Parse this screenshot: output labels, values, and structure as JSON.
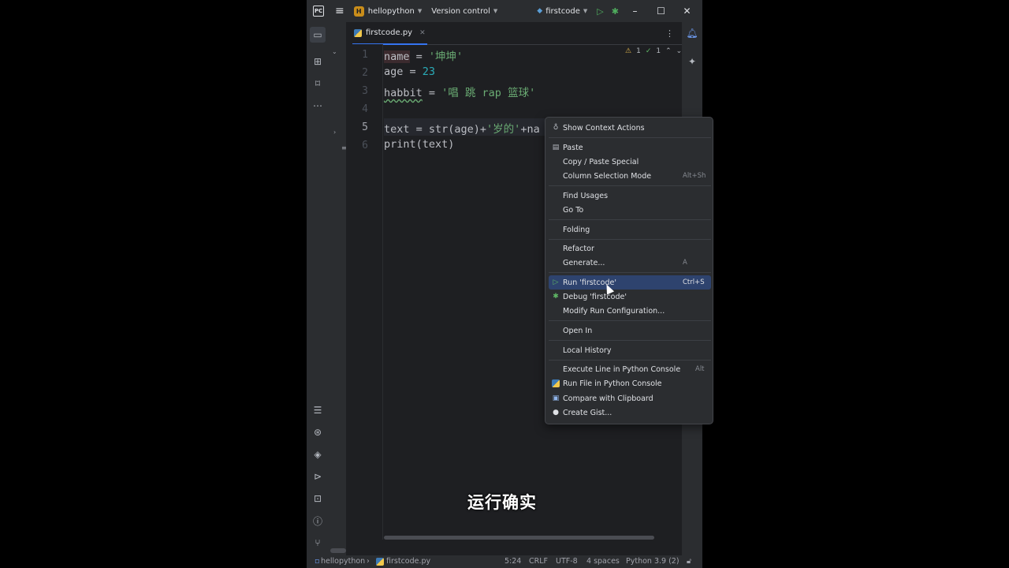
{
  "titlebar": {
    "project_badge": "H",
    "project_name": "hellopython",
    "vcs": "Version control",
    "run_config": "firstcode"
  },
  "tab": {
    "filename": "firstcode.py"
  },
  "editor": {
    "line_numbers": [
      "1",
      "2",
      "3",
      "4",
      "5",
      "6"
    ],
    "lines": [
      {
        "parts": [
          [
            "name",
            ""
          ],
          [
            " = ",
            ""
          ],
          [
            "'坤坤'",
            "str"
          ]
        ]
      },
      {
        "parts": [
          [
            "age = ",
            ""
          ],
          [
            "23",
            "num"
          ]
        ]
      },
      {
        "parts": [
          [
            "habbit",
            ""
          ],
          [
            " = ",
            ""
          ],
          [
            "'唱 跳 rap 篮球'",
            "str"
          ]
        ]
      },
      {
        "parts": []
      },
      {
        "parts": [
          [
            "text = str(age)+",
            ""
          ],
          [
            "'岁的'",
            "str"
          ],
          [
            "+na",
            ""
          ]
        ]
      },
      {
        "parts": [
          [
            "print(text)",
            ""
          ]
        ]
      }
    ],
    "inspections": {
      "warnings": "1",
      "ok": "1"
    }
  },
  "context_menu": {
    "items": [
      {
        "label": "Show Context Actions",
        "icon": "bulb-icon",
        "shortcut": ""
      },
      {
        "sep": true
      },
      {
        "label": "Paste",
        "icon": "clipboard-icon",
        "shortcut": ""
      },
      {
        "label": "Copy / Paste Special",
        "icon": "",
        "shortcut": ""
      },
      {
        "label": "Column Selection Mode",
        "icon": "",
        "shortcut": "Alt+Sh"
      },
      {
        "sep": true
      },
      {
        "label": "Find Usages",
        "icon": "",
        "shortcut": ""
      },
      {
        "label": "Go To",
        "icon": "",
        "shortcut": ""
      },
      {
        "sep": true
      },
      {
        "label": "Folding",
        "icon": "",
        "shortcut": ""
      },
      {
        "sep": true
      },
      {
        "label": "Refactor",
        "icon": "",
        "shortcut": ""
      },
      {
        "label": "Generate...",
        "icon": "",
        "shortcut": "A"
      },
      {
        "sep": true
      },
      {
        "label": "Run 'firstcode'",
        "icon": "run-icon",
        "shortcut": "Ctrl+S",
        "selected": true
      },
      {
        "label": "Debug 'firstcode'",
        "icon": "debug-icon",
        "shortcut": ""
      },
      {
        "label": "Modify Run Configuration...",
        "icon": "",
        "shortcut": ""
      },
      {
        "sep": true
      },
      {
        "label": "Open In",
        "icon": "",
        "shortcut": ""
      },
      {
        "sep": true
      },
      {
        "label": "Local History",
        "icon": "",
        "shortcut": ""
      },
      {
        "sep": true
      },
      {
        "label": "Execute Line in Python Console",
        "icon": "",
        "shortcut": "Alt"
      },
      {
        "label": "Run File in Python Console",
        "icon": "python-icon",
        "shortcut": ""
      },
      {
        "label": "Compare with Clipboard",
        "icon": "compare-icon",
        "shortcut": ""
      },
      {
        "label": "Create Gist...",
        "icon": "github-icon",
        "shortcut": ""
      }
    ]
  },
  "statusbar": {
    "project": "hellopython",
    "file": "firstcode.py",
    "position": "5:24",
    "line_sep": "CRLF",
    "encoding": "UTF-8",
    "indent": "4 spaces",
    "interpreter": "Python 3.9 (2)"
  },
  "subtitle": "运行确实",
  "colors": {
    "accent": "#3574f0",
    "selection": "#2e436e",
    "string": "#6aab73",
    "number": "#2aacb8"
  }
}
